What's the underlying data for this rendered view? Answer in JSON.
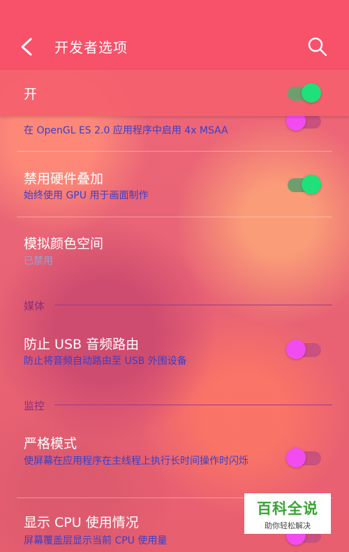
{
  "header": {
    "title": "开发者选项"
  },
  "master_switch": {
    "label": "开",
    "state": "on"
  },
  "items": [
    {
      "title": "",
      "subtitle": "在 OpenGL ES 2.0 应用程序中启用 4x MSAA",
      "toggle": "off"
    },
    {
      "title": "禁用硬件叠加",
      "subtitle": "始终使用 GPU 用于画面制作",
      "toggle": "on"
    },
    {
      "title": "模拟颜色空间",
      "subtitle": "已禁用"
    },
    {
      "title": "防止 USB 音频路由",
      "subtitle": "防止将音频自动路由至 USB 外围设备",
      "toggle": "off"
    },
    {
      "title": "严格模式",
      "subtitle": "使屏幕在应用程序在主线程上执行长时间操作时闪烁",
      "toggle": "off"
    },
    {
      "title": "显示 CPU 使用情况",
      "subtitle": "屏幕覆盖层显示当前 CPU 使用量",
      "toggle": "off"
    }
  ],
  "sections": {
    "media": "媒体",
    "monitoring": "监控"
  },
  "watermark": {
    "brand": "百科全说",
    "tagline": "助你轻松解决"
  },
  "colors": {
    "appbar": "#f8516a",
    "toggle_on": "#1fe07a",
    "toggle_off": "#f24cf0",
    "subtitle": "#3b3fc8"
  }
}
